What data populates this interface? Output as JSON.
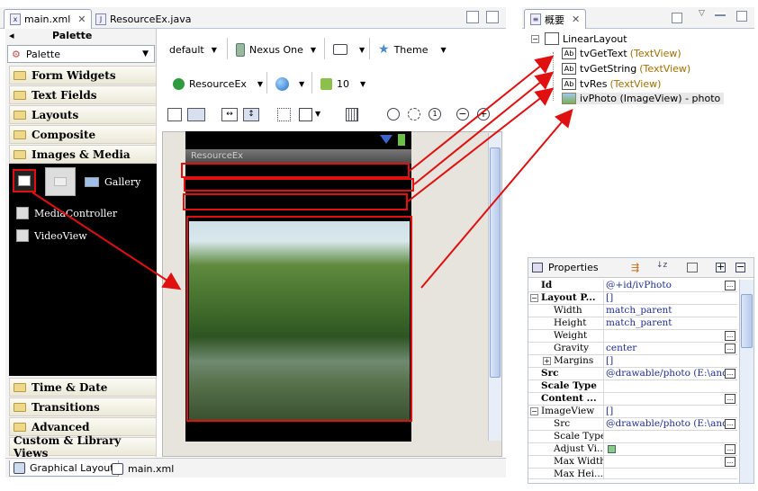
{
  "editor_tabs": [
    {
      "label": "main.xml",
      "active": true
    },
    {
      "label": "ResourceEx.java",
      "active": false
    }
  ],
  "palette": {
    "title": "Palette",
    "select_value": "Palette",
    "categories": {
      "form_widgets": "Form Widgets",
      "text_fields": "Text Fields",
      "layouts": "Layouts",
      "composite": "Composite",
      "images_media": "Images & Media",
      "time_date": "Time & Date",
      "transitions": "Transitions",
      "advanced": "Advanced",
      "custom": "Custom & Library Views"
    },
    "widgets": {
      "gallery": "Gallery",
      "media_controller": "MediaController",
      "video_view": "VideoView"
    }
  },
  "toolbar": {
    "theme_config": "default",
    "device": "Nexus One",
    "theme": "Theme",
    "activity": "ResourceEx",
    "api_level": "10"
  },
  "device": {
    "app_title": "ResourceEx"
  },
  "bottom_tabs": [
    {
      "label": "Graphical Layout",
      "active": true
    },
    {
      "label": "main.xml",
      "active": false
    }
  ],
  "outline": {
    "tab_label": "概要",
    "root": "LinearLayout",
    "children": [
      {
        "name": "tvGetText",
        "type": "(TextView)"
      },
      {
        "name": "tvGetString",
        "type": "(TextView)"
      },
      {
        "name": "tvRes",
        "type": "(TextView)"
      },
      {
        "name": "ivPhoto (ImageView) - photo",
        "type": ""
      }
    ]
  },
  "properties": {
    "title": "Properties",
    "rows": [
      {
        "key": "Id",
        "value": "@+id/ivPhoto"
      },
      {
        "key": "Layout P...",
        "value": "[]"
      },
      {
        "key": "Width",
        "value": "match_parent"
      },
      {
        "key": "Height",
        "value": "match_parent"
      },
      {
        "key": "Weight",
        "value": ""
      },
      {
        "key": "Gravity",
        "value": "center"
      },
      {
        "key": "Margins",
        "value": "[]"
      },
      {
        "key": "Src",
        "value": "@drawable/photo (E:\\and..."
      },
      {
        "key": "Scale Type",
        "value": ""
      },
      {
        "key": "Content ...",
        "value": ""
      },
      {
        "key": "ImageView",
        "value": "[]"
      },
      {
        "key": "Src",
        "value": "@drawable/photo (E:\\and..."
      },
      {
        "key": "Scale Type",
        "value": ""
      },
      {
        "key": "Adjust Vi...",
        "value": ""
      },
      {
        "key": "Max Width",
        "value": ""
      },
      {
        "key": "Max Hei...",
        "value": ""
      }
    ]
  },
  "colors": {
    "annotation_red": "#e01010",
    "type_label": "#a07000",
    "value_text": "#203090"
  }
}
